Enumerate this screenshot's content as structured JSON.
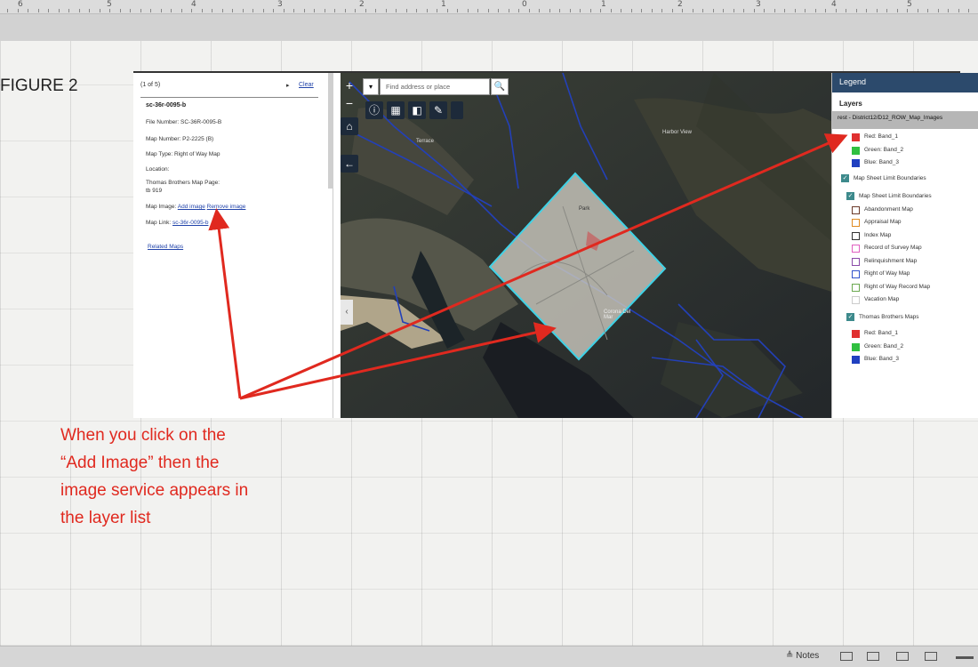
{
  "ruler": {
    "numbers": [
      "6",
      "5",
      "4",
      "3",
      "2",
      "1",
      "0",
      "1",
      "2",
      "3",
      "4",
      "5"
    ]
  },
  "figure_label": "FIGURE 2",
  "panel": {
    "pager": "(1 of 5)",
    "next": "▸",
    "clear": "Clear",
    "record_title": "sc-36r-0095-b",
    "file_number": "File Number: SC-36R-0095-B",
    "map_number": "Map Number: P2-2225 (B)",
    "map_type": "Map Type: Right of Way Map",
    "location": "Location:",
    "thomas_label": "Thomas Brothers Map Page:",
    "thomas_value": "tb 919",
    "map_image_label": "Map Image:",
    "add_image": "Add image",
    "remove_image": "Remove image",
    "map_link_label": "Map Link:",
    "map_link": "sc-36r-0095-b",
    "related_maps": "Related Maps"
  },
  "map": {
    "search_placeholder": "Find address or place",
    "dropdown": "▾",
    "search_icon": "🔍",
    "zoom_in": "+",
    "zoom_out": "−",
    "collapse": "‹",
    "labels": {
      "harbor_view": "Harbor View",
      "terrace": "Terrace",
      "park": "Park",
      "del_mar": "Corona Del Mar"
    }
  },
  "legend": {
    "title": "Legend",
    "layers_heading": "Layers",
    "service": "rest - District12/D12_ROW_Map_Images",
    "band_red_1": "Red: Band_1",
    "band_green_1": "Green: Band_2",
    "band_blue_1": "Blue: Band_3",
    "msl_group": "Map Sheet Limit Boundaries",
    "msl_sub": "Map Sheet Limit Boundaries",
    "items": [
      {
        "label": "Abandonment Map",
        "color": "#6b3a2a"
      },
      {
        "label": "Appraisal Map",
        "color": "#e08a20"
      },
      {
        "label": "Index Map",
        "color": "#333333"
      },
      {
        "label": "Record of Survey Map",
        "color": "#e060c0"
      },
      {
        "label": "Relinquishment Map",
        "color": "#8a4aa8"
      },
      {
        "label": "Right of Way Map",
        "color": "#3355cc"
      },
      {
        "label": "Right of Way Record Map",
        "color": "#6aa84f"
      },
      {
        "label": "Vacation Map",
        "color": "#cccccc"
      }
    ],
    "tb_group": "Thomas Brothers Maps",
    "band_red_2": "Red: Band_1",
    "band_green_2": "Green: Band_2",
    "band_blue_2": "Blue: Band_3",
    "colors": {
      "red": "#e03030",
      "green": "#30c040",
      "blue": "#2040c0"
    }
  },
  "annotation": {
    "line1": "When you click on the",
    "line2": "“Add Image” then the",
    "line3": "image service appears in",
    "line4": "the layer list",
    "color": "#e0291f"
  },
  "status": {
    "notes": "≜ Notes"
  }
}
